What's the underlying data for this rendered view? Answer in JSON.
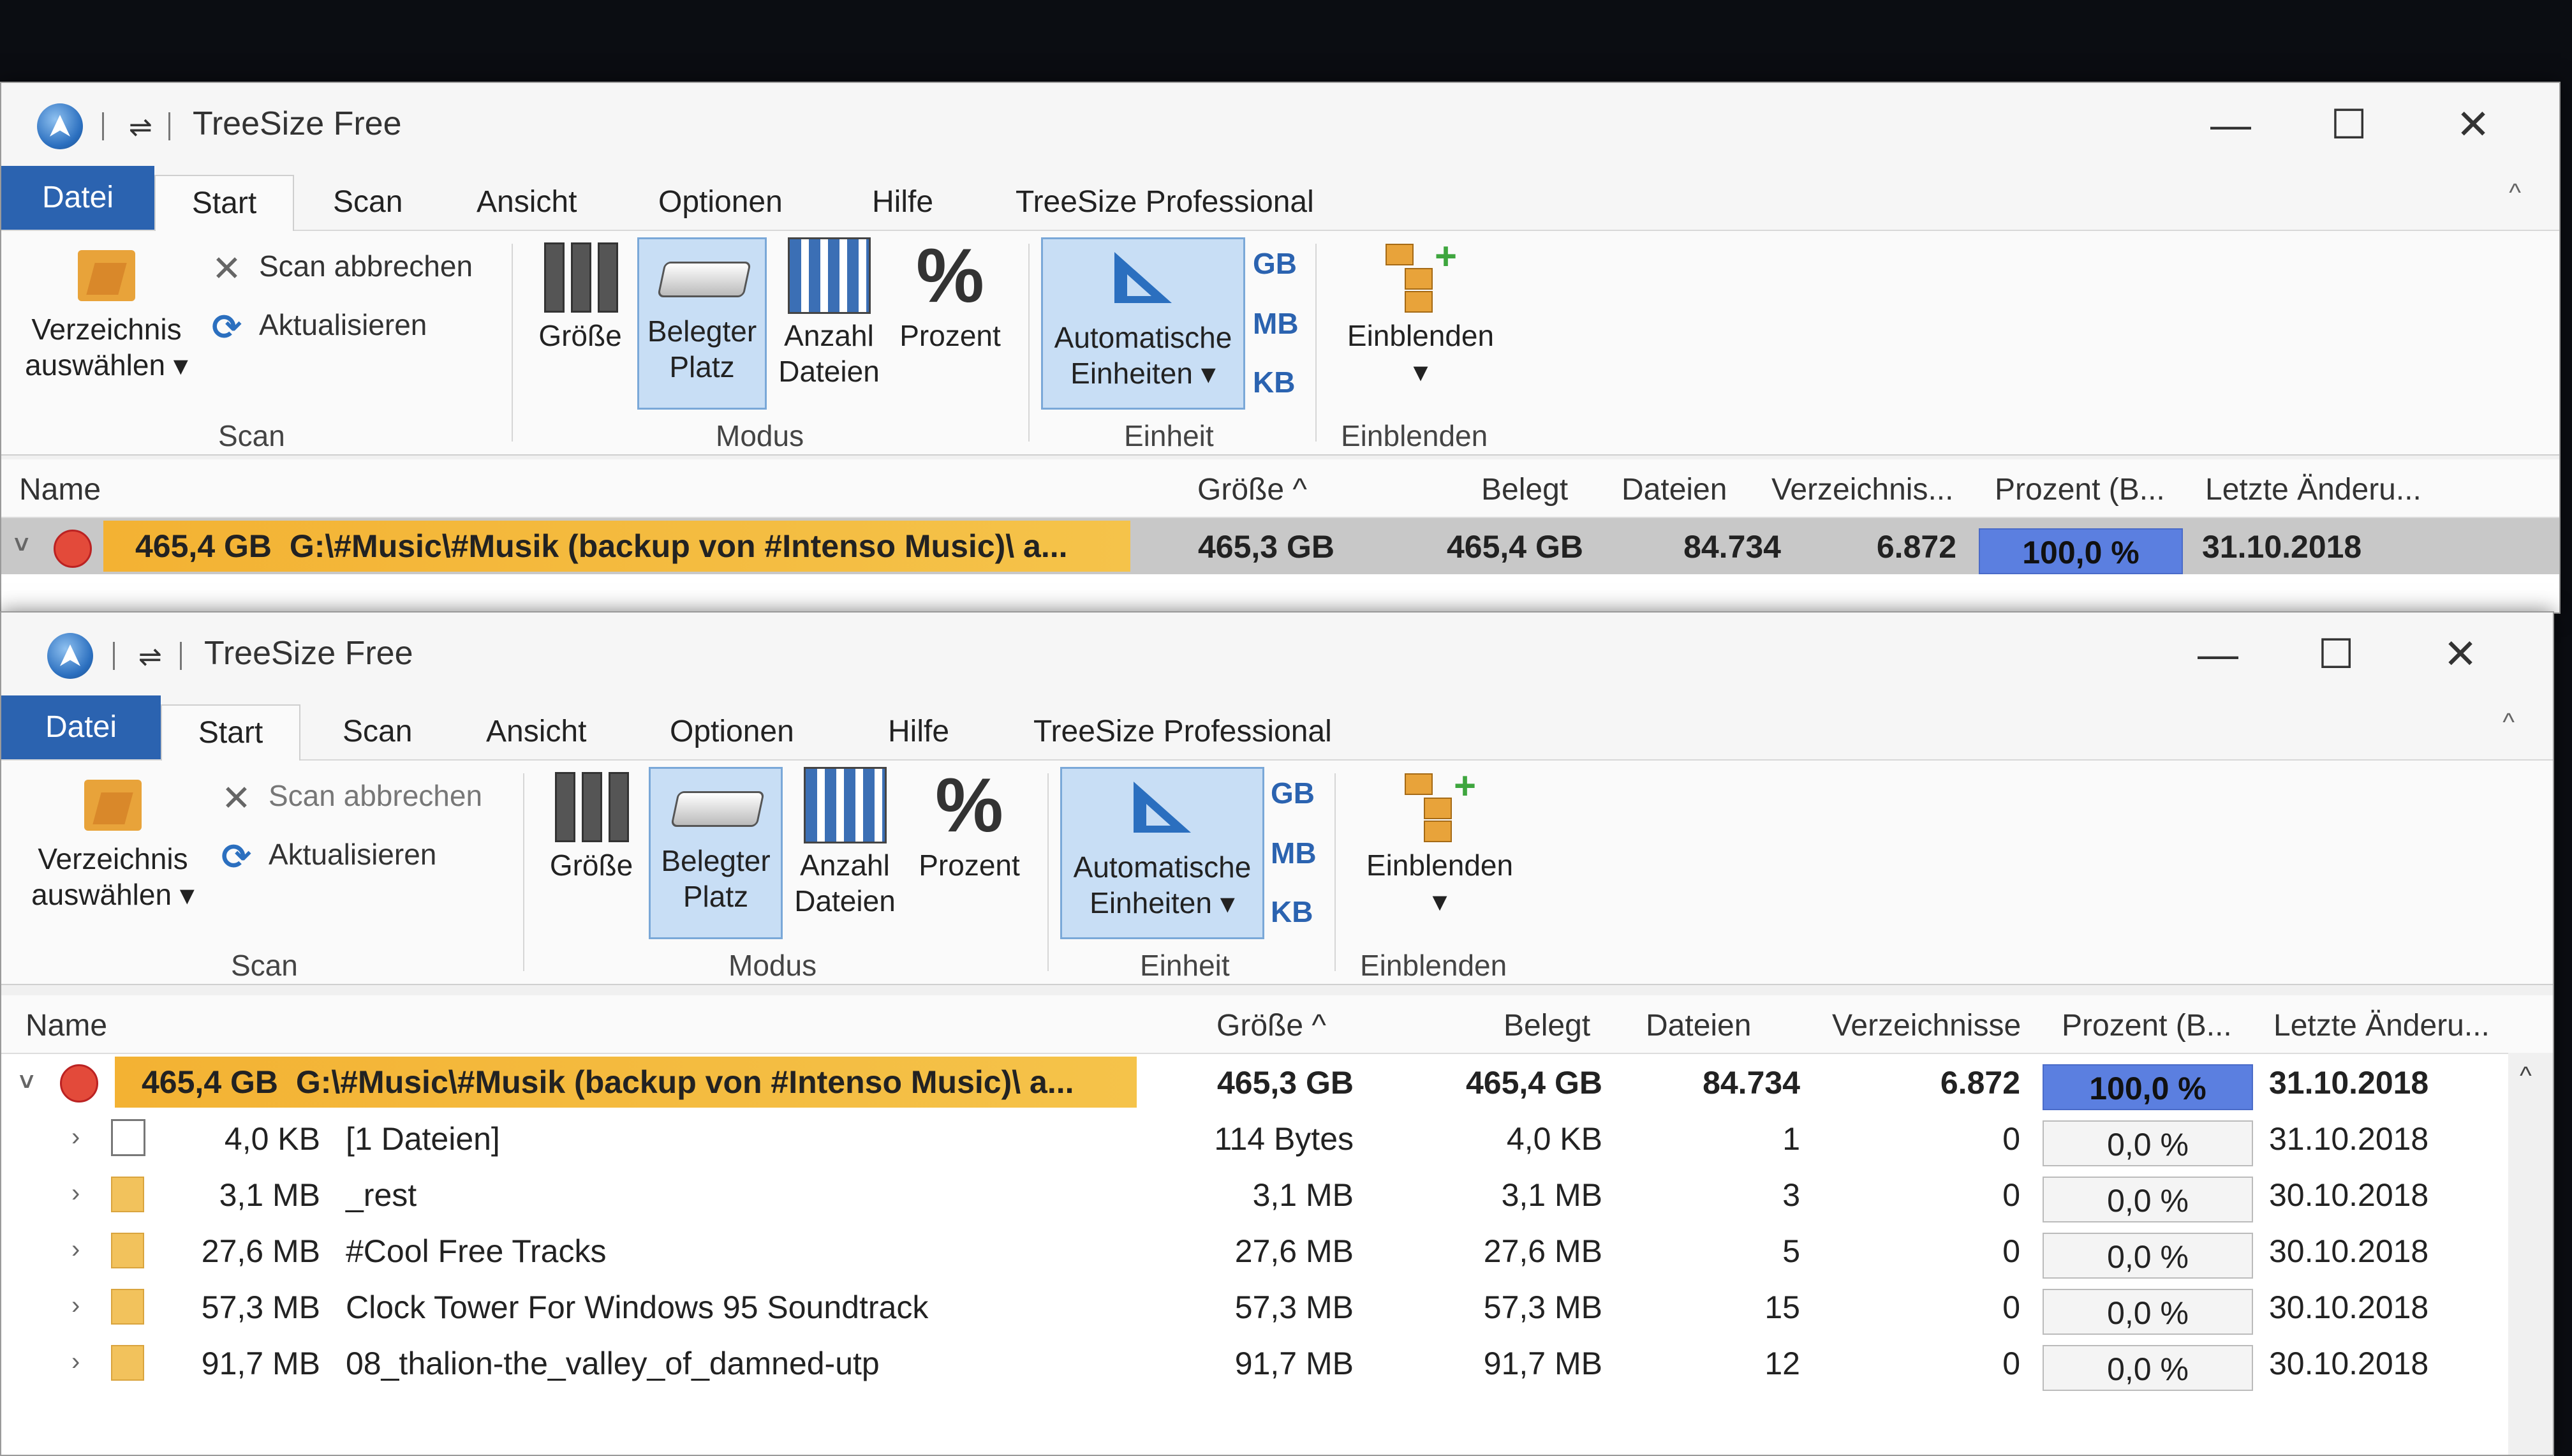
{
  "app": {
    "title": "TreeSize Free",
    "qa_symbol": "⇌",
    "controls": {
      "minimize": "—",
      "maximize": "☐",
      "close": "✕"
    },
    "collapse_symbol": "^"
  },
  "menu": {
    "tabs": [
      "Datei",
      "Start",
      "Scan",
      "Ansicht",
      "Optionen",
      "Hilfe",
      "TreeSize Professional"
    ]
  },
  "ribbon": {
    "scan": {
      "select_dir_line1": "Verzeichnis",
      "select_dir_line2": "auswählen ▾",
      "cancel_scan": "Scan abbrechen",
      "refresh": "Aktualisieren",
      "group_label": "Scan"
    },
    "modus": {
      "size": "Größe",
      "allocated_line1": "Belegter",
      "allocated_line2": "Platz",
      "count_line1": "Anzahl",
      "count_line2": "Dateien",
      "percent": "Prozent",
      "percent_icon": "%",
      "group_label": "Modus"
    },
    "einheit": {
      "auto_line1": "Automatische",
      "auto_line2": "Einheiten ▾",
      "gb": "GB",
      "mb": "MB",
      "kb": "KB",
      "group_label": "Einheit"
    },
    "einblenden": {
      "button": "Einblenden",
      "arrow": "▾",
      "group_label": "Einblenden"
    }
  },
  "columns_back": {
    "name": "Name",
    "size": "Größe ^",
    "allocated": "Belegt",
    "files": "Dateien",
    "dirs": "Verzeichnis...",
    "percent": "Prozent (B...",
    "modified": "Letzte Änderu..."
  },
  "columns_front": {
    "name": "Name",
    "size": "Größe ^",
    "allocated": "Belegt",
    "files": "Dateien",
    "dirs": "Verzeichnisse",
    "percent": "Prozent (B...",
    "modified": "Letzte Änderu..."
  },
  "rows": [
    {
      "expander": "˅",
      "icon": "drive",
      "name_size": "465,4 GB",
      "name": "G:\\#Music\\#Musik (backup von #Intenso Music)\\  a...",
      "size": "465,3 GB",
      "allocated": "465,4 GB",
      "files": "84.734",
      "dirs": "6.872",
      "percent": "100,0 %",
      "pct_value": 100,
      "modified": "31.10.2018"
    },
    {
      "expander": "›",
      "icon": "file",
      "name_size": "4,0 KB",
      "name": "[1 Dateien]",
      "size": "114 Bytes",
      "allocated": "4,0 KB",
      "files": "1",
      "dirs": "0",
      "percent": "0,0 %",
      "pct_value": 0,
      "modified": "31.10.2018"
    },
    {
      "expander": "›",
      "icon": "folder",
      "name_size": "3,1 MB",
      "name": "_rest",
      "size": "3,1 MB",
      "allocated": "3,1 MB",
      "files": "3",
      "dirs": "0",
      "percent": "0,0 %",
      "pct_value": 0,
      "modified": "30.10.2018"
    },
    {
      "expander": "›",
      "icon": "folder",
      "name_size": "27,6 MB",
      "name": "#Cool Free Tracks",
      "size": "27,6 MB",
      "allocated": "27,6 MB",
      "files": "5",
      "dirs": "0",
      "percent": "0,0 %",
      "pct_value": 0,
      "modified": "30.10.2018"
    },
    {
      "expander": "›",
      "icon": "folder",
      "name_size": "57,3 MB",
      "name": "Clock Tower For Windows 95 Soundtrack",
      "size": "57,3 MB",
      "allocated": "57,3 MB",
      "files": "15",
      "dirs": "0",
      "percent": "0,0 %",
      "pct_value": 0,
      "modified": "30.10.2018"
    },
    {
      "expander": "›",
      "icon": "folder",
      "name_size": "91,7 MB",
      "name": "08_thalion-the_valley_of_damned-utp",
      "size": "91,7 MB",
      "allocated": "91,7 MB",
      "files": "12",
      "dirs": "0",
      "percent": "0,0 %",
      "pct_value": 0,
      "modified": "30.10.2018"
    }
  ]
}
